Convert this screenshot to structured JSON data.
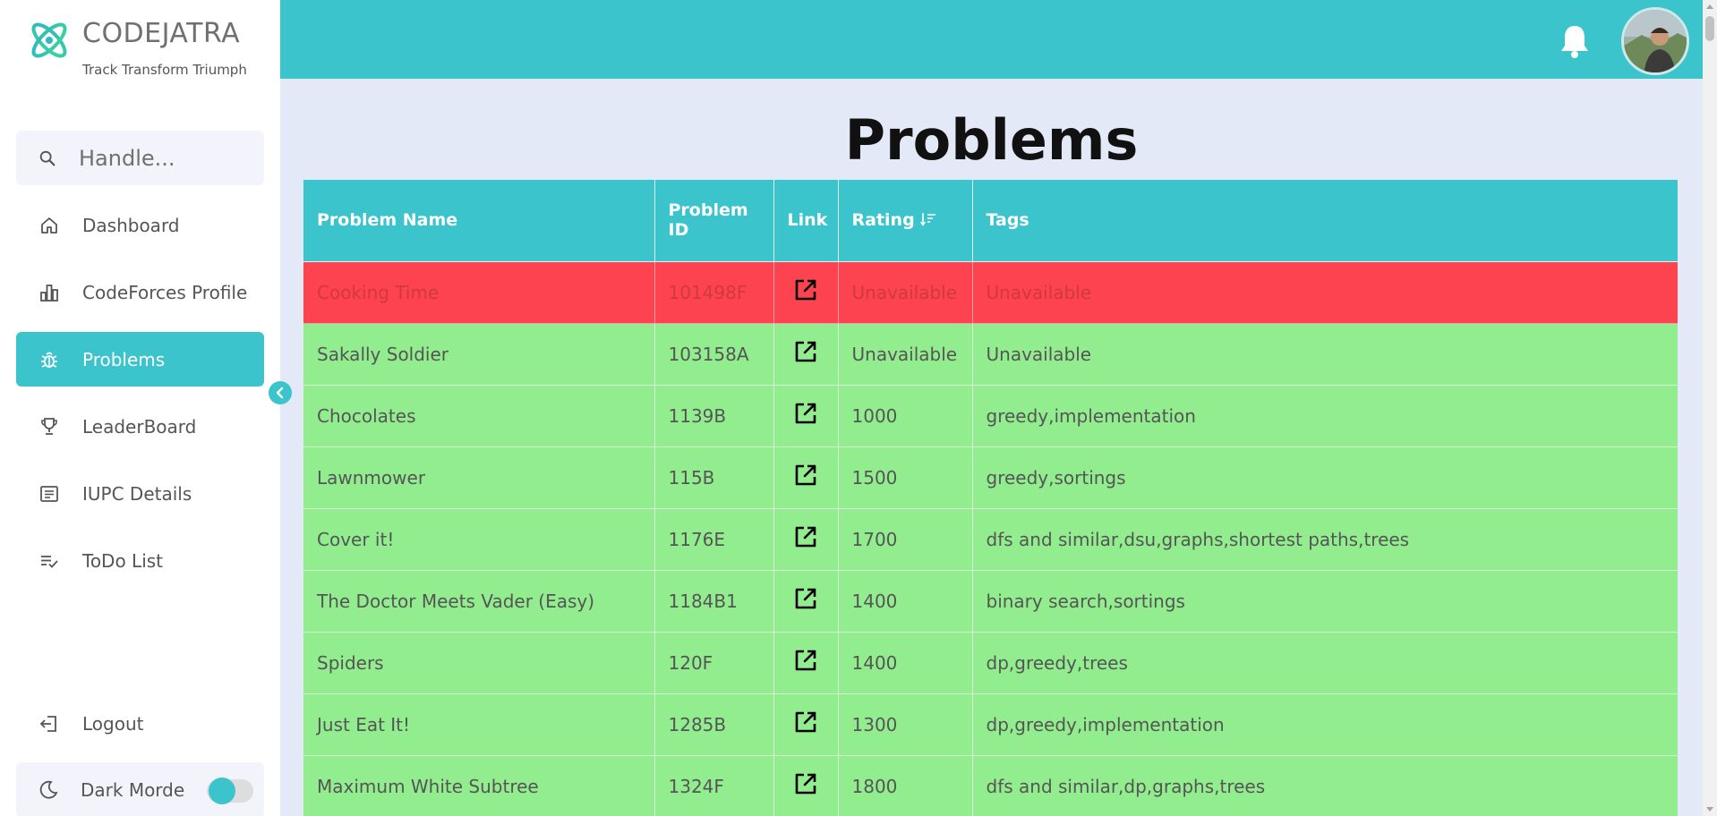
{
  "brand": {
    "name": "CODEJATRA",
    "tagline": "Track Transform Triumph"
  },
  "search": {
    "placeholder": "Handle..."
  },
  "sidebar": {
    "items": [
      {
        "label": "Dashboard",
        "icon": "home-icon"
      },
      {
        "label": "CodeForces Profile",
        "icon": "bar-chart-icon"
      },
      {
        "label": "Problems",
        "icon": "bug-icon",
        "active": true
      },
      {
        "label": "LeaderBoard",
        "icon": "trophy-icon"
      },
      {
        "label": "IUPC Details",
        "icon": "document-icon"
      },
      {
        "label": "ToDo List",
        "icon": "checklist-icon"
      }
    ],
    "logout": "Logout",
    "dark_mode": "Dark Morde"
  },
  "page": {
    "title": "Problems"
  },
  "table": {
    "headers": {
      "name": "Problem Name",
      "id": "Problem ID",
      "link": "Link",
      "rating": "Rating",
      "tags": "Tags"
    },
    "rows": [
      {
        "name": "Cooking Time",
        "id": "101498F",
        "rating": "Unavailable",
        "tags": "Unavailable",
        "status": "unavailable"
      },
      {
        "name": "Sakally Soldier",
        "id": "103158A",
        "rating": "Unavailable",
        "tags": "Unavailable",
        "status": "ok"
      },
      {
        "name": "Chocolates",
        "id": "1139B",
        "rating": "1000",
        "tags": "greedy,implementation",
        "status": "ok"
      },
      {
        "name": "Lawnmower",
        "id": "115B",
        "rating": "1500",
        "tags": "greedy,sortings",
        "status": "ok"
      },
      {
        "name": "Cover it!",
        "id": "1176E",
        "rating": "1700",
        "tags": "dfs and similar,dsu,graphs,shortest paths,trees",
        "status": "ok"
      },
      {
        "name": "The Doctor Meets Vader (Easy)",
        "id": "1184B1",
        "rating": "1400",
        "tags": "binary search,sortings",
        "status": "ok"
      },
      {
        "name": "Spiders",
        "id": "120F",
        "rating": "1400",
        "tags": "dp,greedy,trees",
        "status": "ok"
      },
      {
        "name": "Just Eat It!",
        "id": "1285B",
        "rating": "1300",
        "tags": "dp,greedy,implementation",
        "status": "ok"
      },
      {
        "name": "Maximum White Subtree",
        "id": "1324F",
        "rating": "1800",
        "tags": "dfs and similar,dp,graphs,trees",
        "status": "ok"
      }
    ]
  },
  "colors": {
    "accent": "#3bc4cb",
    "row_ok": "#92ed8f",
    "row_unavailable": "#fc434f"
  }
}
